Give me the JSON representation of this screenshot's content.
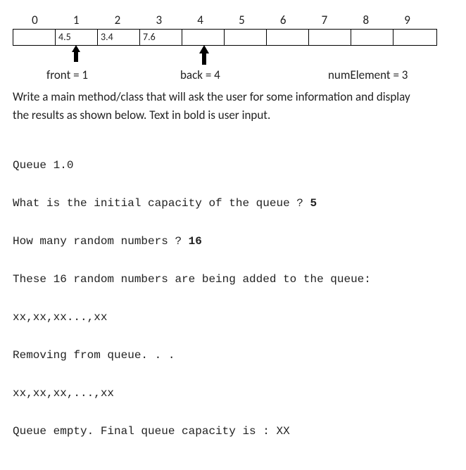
{
  "array": {
    "indices": [
      "0",
      "1",
      "2",
      "3",
      "4",
      "5",
      "6",
      "7",
      "8",
      "9"
    ],
    "cells": [
      "",
      "4.5",
      "3.4",
      "7.6",
      "",
      "",
      "",
      "",
      "",
      ""
    ],
    "front_label": "front  = 1",
    "back_label": "back   = 4",
    "num_label": "numElement = 3"
  },
  "instruction": "Write a main method/class that will ask the user for some information and display the results as shown below. Text in bold is user input.",
  "run": {
    "line1": "Queue 1.0",
    "line2a": "What is the initial capacity of the queue ? ",
    "line2b": "5",
    "line3a": "How many random numbers ? ",
    "line3b": "16",
    "line4": "These 16 random numbers are being added to the queue:",
    "line5": "xx,xx,xx...,xx",
    "line6": "Removing from queue. . .",
    "line7": "xx,xx,xx,...,xx",
    "line8": "Queue empty. Final queue capacity is : XX"
  }
}
